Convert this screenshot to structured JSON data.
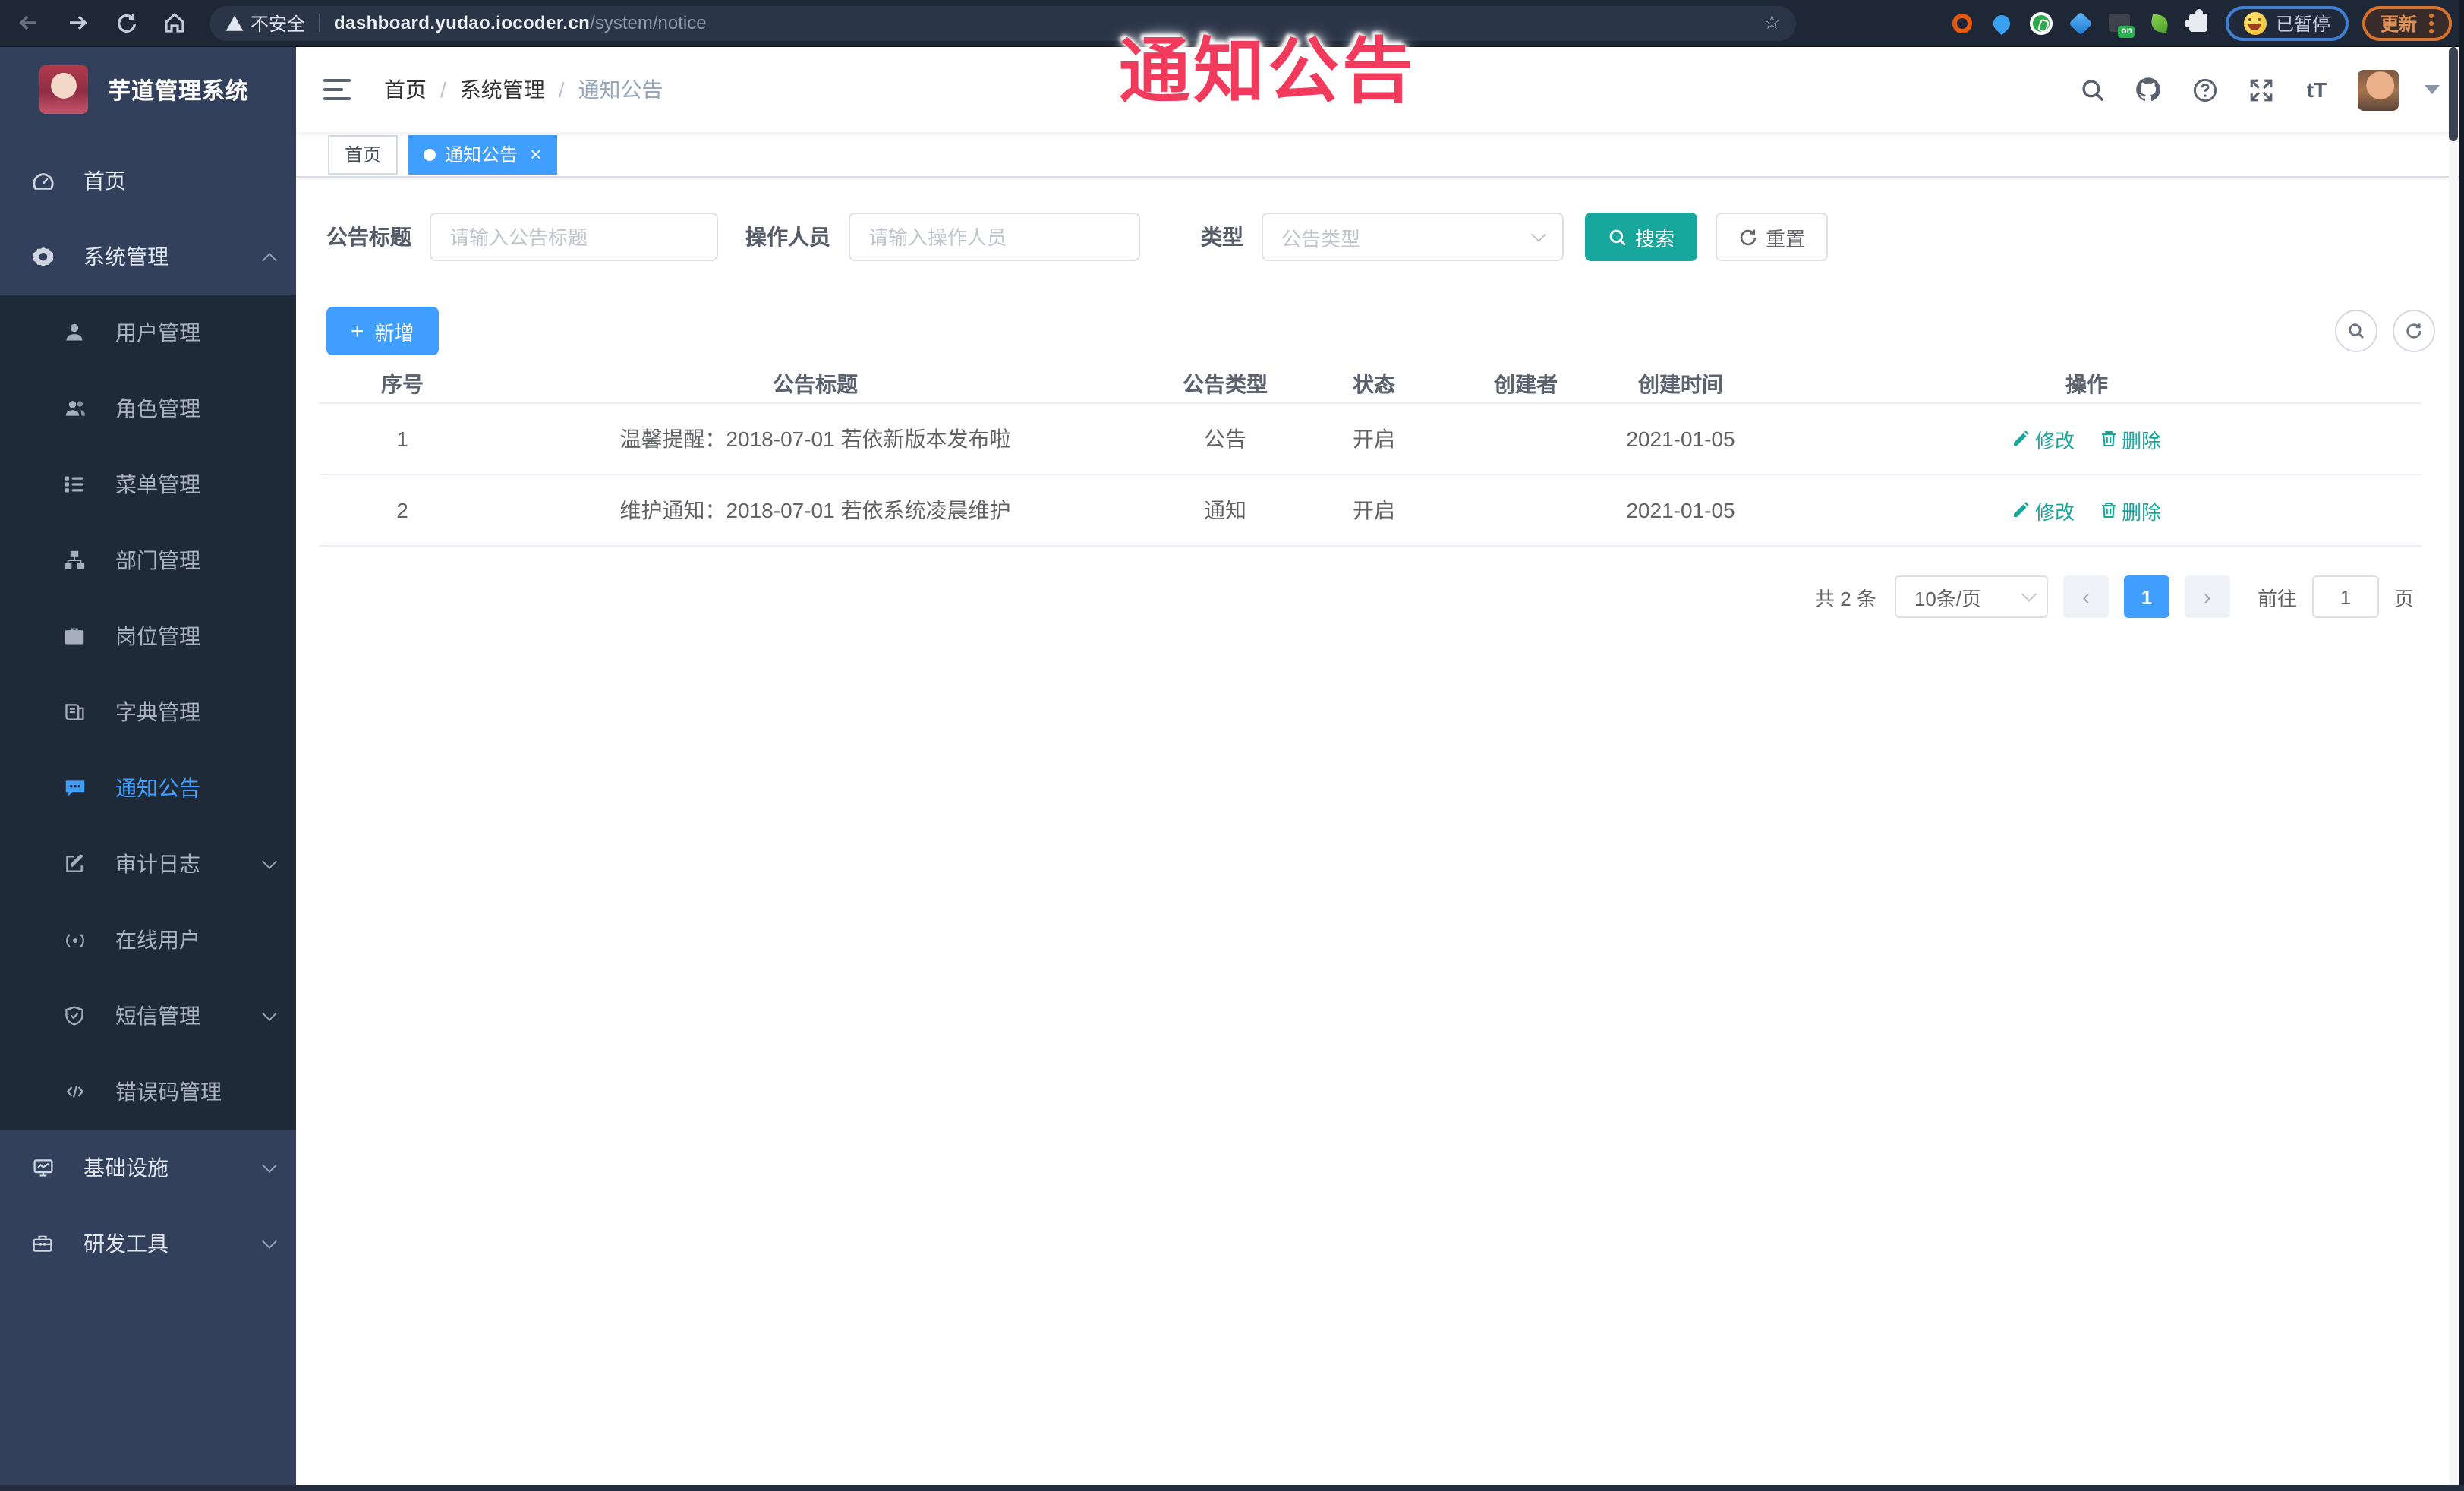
{
  "browser": {
    "security_label": "不安全",
    "url_host": "dashboard.yudao.iocoder.cn",
    "url_path": "/system/notice",
    "paused_label": "已暂停",
    "update_label": "更新",
    "extension_badge": "on"
  },
  "overlay": {
    "text": "通知公告"
  },
  "sidebar": {
    "app_title": "芋道管理系统",
    "items": [
      {
        "label": "首页"
      },
      {
        "label": "系统管理"
      },
      {
        "label": "用户管理"
      },
      {
        "label": "角色管理"
      },
      {
        "label": "菜单管理"
      },
      {
        "label": "部门管理"
      },
      {
        "label": "岗位管理"
      },
      {
        "label": "字典管理"
      },
      {
        "label": "通知公告"
      },
      {
        "label": "审计日志"
      },
      {
        "label": "在线用户"
      },
      {
        "label": "短信管理"
      },
      {
        "label": "错误码管理"
      },
      {
        "label": "基础设施"
      },
      {
        "label": "研发工具"
      }
    ]
  },
  "header": {
    "breadcrumb": [
      "首页",
      "系统管理",
      "通知公告"
    ],
    "separator": "/",
    "font_icon_label": "tT"
  },
  "tabs": {
    "home": "首页",
    "active": "通知公告",
    "close_glyph": "×"
  },
  "filters": {
    "title_label": "公告标题",
    "title_placeholder": "请输入公告标题",
    "operator_label": "操作人员",
    "operator_placeholder": "请输入操作人员",
    "type_label": "类型",
    "type_placeholder": "公告类型",
    "search_label": "搜索",
    "reset_label": "重置"
  },
  "toolbar": {
    "add_glyph": "+",
    "add_label": "新增"
  },
  "table": {
    "columns": [
      "序号",
      "公告标题",
      "公告类型",
      "状态",
      "创建者",
      "创建时间",
      "操作"
    ],
    "rows": [
      {
        "no": "1",
        "title": "温馨提醒：2018-07-01 若依新版本发布啦",
        "type": "公告",
        "status": "开启",
        "creator": "",
        "created": "2021-01-05"
      },
      {
        "no": "2",
        "title": "维护通知：2018-07-01 若依系统凌晨维护",
        "type": "通知",
        "status": "开启",
        "creator": "",
        "created": "2021-01-05"
      }
    ],
    "edit_label": "修改",
    "delete_label": "删除"
  },
  "pagination": {
    "total": "共 2 条",
    "page_size": "10条/页",
    "prev": "‹",
    "current": "1",
    "next": "›",
    "goto_label": "前往",
    "goto_value": "1",
    "unit": "页"
  },
  "colors": {
    "accent": "#409eff",
    "teal": "#18a79c",
    "overlay_red": "#f23a5c"
  }
}
